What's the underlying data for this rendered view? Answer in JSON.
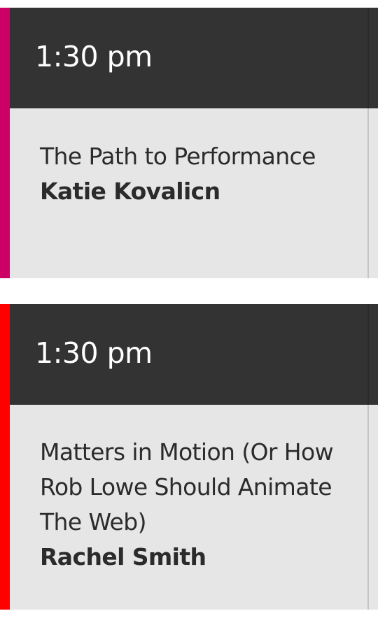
{
  "sessions": [
    {
      "time": "1:30 pm",
      "title": "The Path to Performance",
      "speaker": "Katie Kovalicn",
      "accent_color": "#cc0066"
    },
    {
      "time": "1:30 pm",
      "title": "Matters in Motion (Or How Rob Lowe Should Animate The Web)",
      "speaker": "Rachel Smith",
      "accent_color": "#ff0000"
    }
  ],
  "colors": {
    "header_bg": "#333333",
    "card_bg": "#e6e6e6",
    "text": "#2b2b2b",
    "time_text": "#ffffff"
  }
}
